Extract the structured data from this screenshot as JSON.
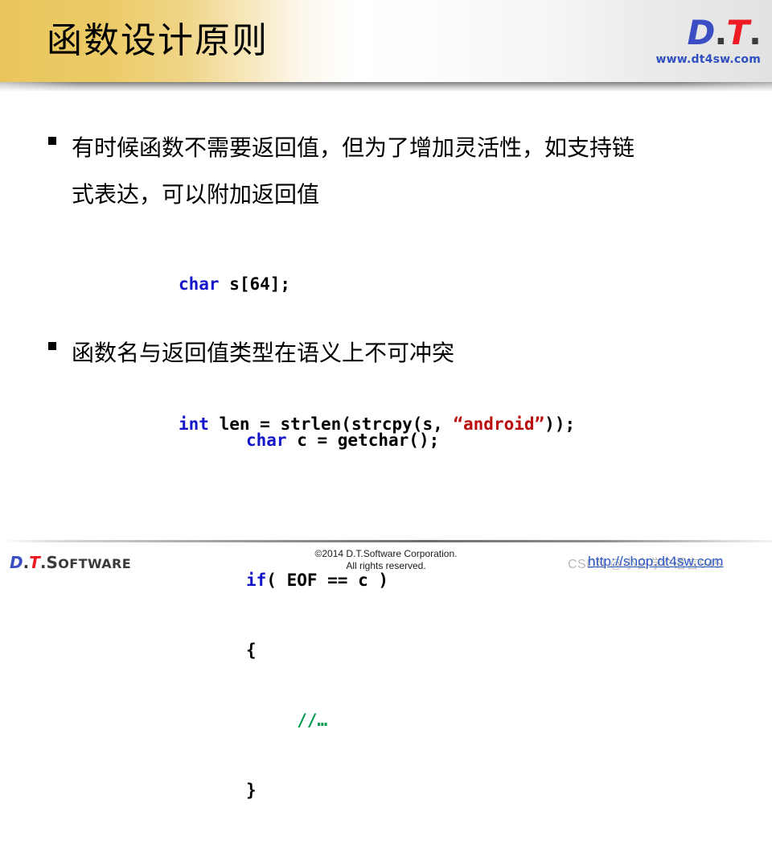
{
  "slide": {
    "title": "函数设计原则"
  },
  "header": {
    "logo": {
      "d": "D",
      "dot1": ".",
      "t": "T",
      "dot2": ".",
      "url": "www.dt4sw.com"
    }
  },
  "body": {
    "bullets": [
      {
        "marker": "square",
        "text": "有时候函数不需要返回值，但为了增加灵活性，如支持链"
      },
      {
        "marker": "continuation",
        "text": "式表达，可以附加返回值"
      },
      {
        "marker": "square",
        "text": "函数名与返回值类型在语义上不可冲突"
      }
    ],
    "code_blocks": [
      {
        "id": "code-block-1",
        "lines": [
          {
            "tokens": [
              {
                "t": "char",
                "c": "kw"
              },
              {
                "t": " s[64];",
                "c": "plain"
              }
            ]
          },
          {
            "tokens": []
          },
          {
            "tokens": [
              {
                "t": "int",
                "c": "kw"
              },
              {
                "t": " len = strlen(strcpy(s, ",
                "c": "plain"
              },
              {
                "t": "“android”",
                "c": "str"
              },
              {
                "t": "));",
                "c": "plain"
              }
            ]
          }
        ]
      },
      {
        "id": "code-block-2",
        "lines": [
          {
            "tokens": [
              {
                "t": "char",
                "c": "kw"
              },
              {
                "t": " c = getchar();",
                "c": "plain"
              }
            ]
          },
          {
            "tokens": []
          },
          {
            "tokens": [
              {
                "t": "if",
                "c": "kw"
              },
              {
                "t": "( EOF == c )",
                "c": "plain"
              }
            ]
          },
          {
            "tokens": [
              {
                "t": "{",
                "c": "plain"
              }
            ]
          },
          {
            "tokens": [
              {
                "t": "     ",
                "c": "plain"
              },
              {
                "t": "//…",
                "c": "cmt"
              }
            ]
          },
          {
            "tokens": [
              {
                "t": "}",
                "c": "plain"
              }
            ]
          }
        ]
      }
    ]
  },
  "footer": {
    "logo": {
      "d": "D",
      "dot1": ".",
      "t": "T",
      "dot2": ".",
      "software_cap": "S",
      "software_rest": "OFTWARE"
    },
    "copyright_line1": "©2014 D.T.Software Corporation.",
    "copyright_line2": "All rights reserved.",
    "watermark_csdn": "CSDN @小白学C语言945",
    "watermark_link": "http://shop.dt4sw.com"
  },
  "colors": {
    "header_gold": "#e9c65c",
    "keyword_blue": "#1414c8",
    "string_red": "#bb0d0d",
    "comment_green": "#009a4e",
    "logo_blue": "#3b4ec4",
    "logo_red": "#ee1b22",
    "link_blue": "#2b57c4"
  }
}
